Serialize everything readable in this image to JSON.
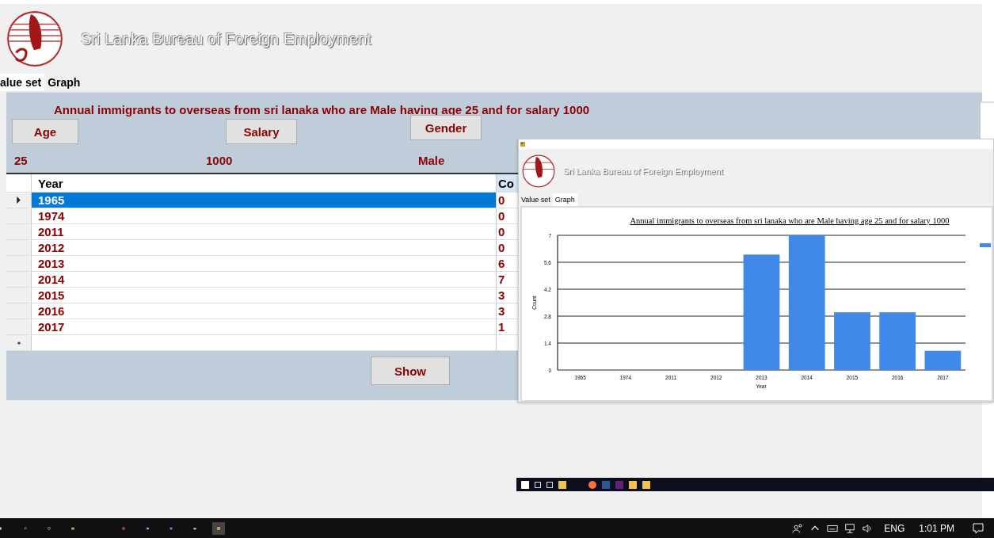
{
  "app": {
    "title": "Sri Lanka Bureau of Foreign Employment"
  },
  "tabs": [
    {
      "label": "alue set",
      "selected": true
    },
    {
      "label": "Graph",
      "selected": false
    }
  ],
  "headline": "Annual immigrants to overseas from sri lanaka   who are Male having age 25 and for salary 1000",
  "filters": [
    {
      "button": "Age",
      "value": "25"
    },
    {
      "button": "Salary",
      "value": "1000"
    },
    {
      "button": "Gender",
      "value": "Male"
    }
  ],
  "grid": {
    "columns": [
      "Year",
      "Co"
    ],
    "rows": [
      {
        "year": "1965",
        "count": "0",
        "selected": true
      },
      {
        "year": "1974",
        "count": "0",
        "selected": false
      },
      {
        "year": "2011",
        "count": "0",
        "selected": false
      },
      {
        "year": "2012",
        "count": "0",
        "selected": false
      },
      {
        "year": "2013",
        "count": "6",
        "selected": false
      },
      {
        "year": "2014",
        "count": "7",
        "selected": false
      },
      {
        "year": "2015",
        "count": "3",
        "selected": false
      },
      {
        "year": "2016",
        "count": "3",
        "selected": false
      },
      {
        "year": "2017",
        "count": "1",
        "selected": false
      }
    ]
  },
  "show_button": "Show",
  "chart_window": {
    "title": "Sri Lanka Bureau of Foreign Employment",
    "tabs": [
      {
        "label": "Value set",
        "selected": false
      },
      {
        "label": "Graph",
        "selected": true
      }
    ],
    "chart_data": {
      "type": "bar",
      "title": "Annual immigrants to overseas from sri lanaka  who are Male having age 25 and for salary 1000",
      "xlabel": "Year",
      "ylabel": "Count",
      "categories": [
        "1965",
        "1974",
        "2011",
        "2012",
        "2013",
        "2014",
        "2015",
        "2016",
        "2017"
      ],
      "series": [
        {
          "color": "#4189e8",
          "values": [
            0,
            0,
            0,
            0,
            6,
            7,
            3,
            3,
            1
          ]
        }
      ],
      "grid": true,
      "ylim": [
        0,
        7
      ],
      "yticks": [
        0,
        1.4,
        2.8,
        4.2,
        5.6,
        7
      ]
    }
  },
  "taskbar": {
    "language": "ENG",
    "time": "1:01 PM"
  }
}
